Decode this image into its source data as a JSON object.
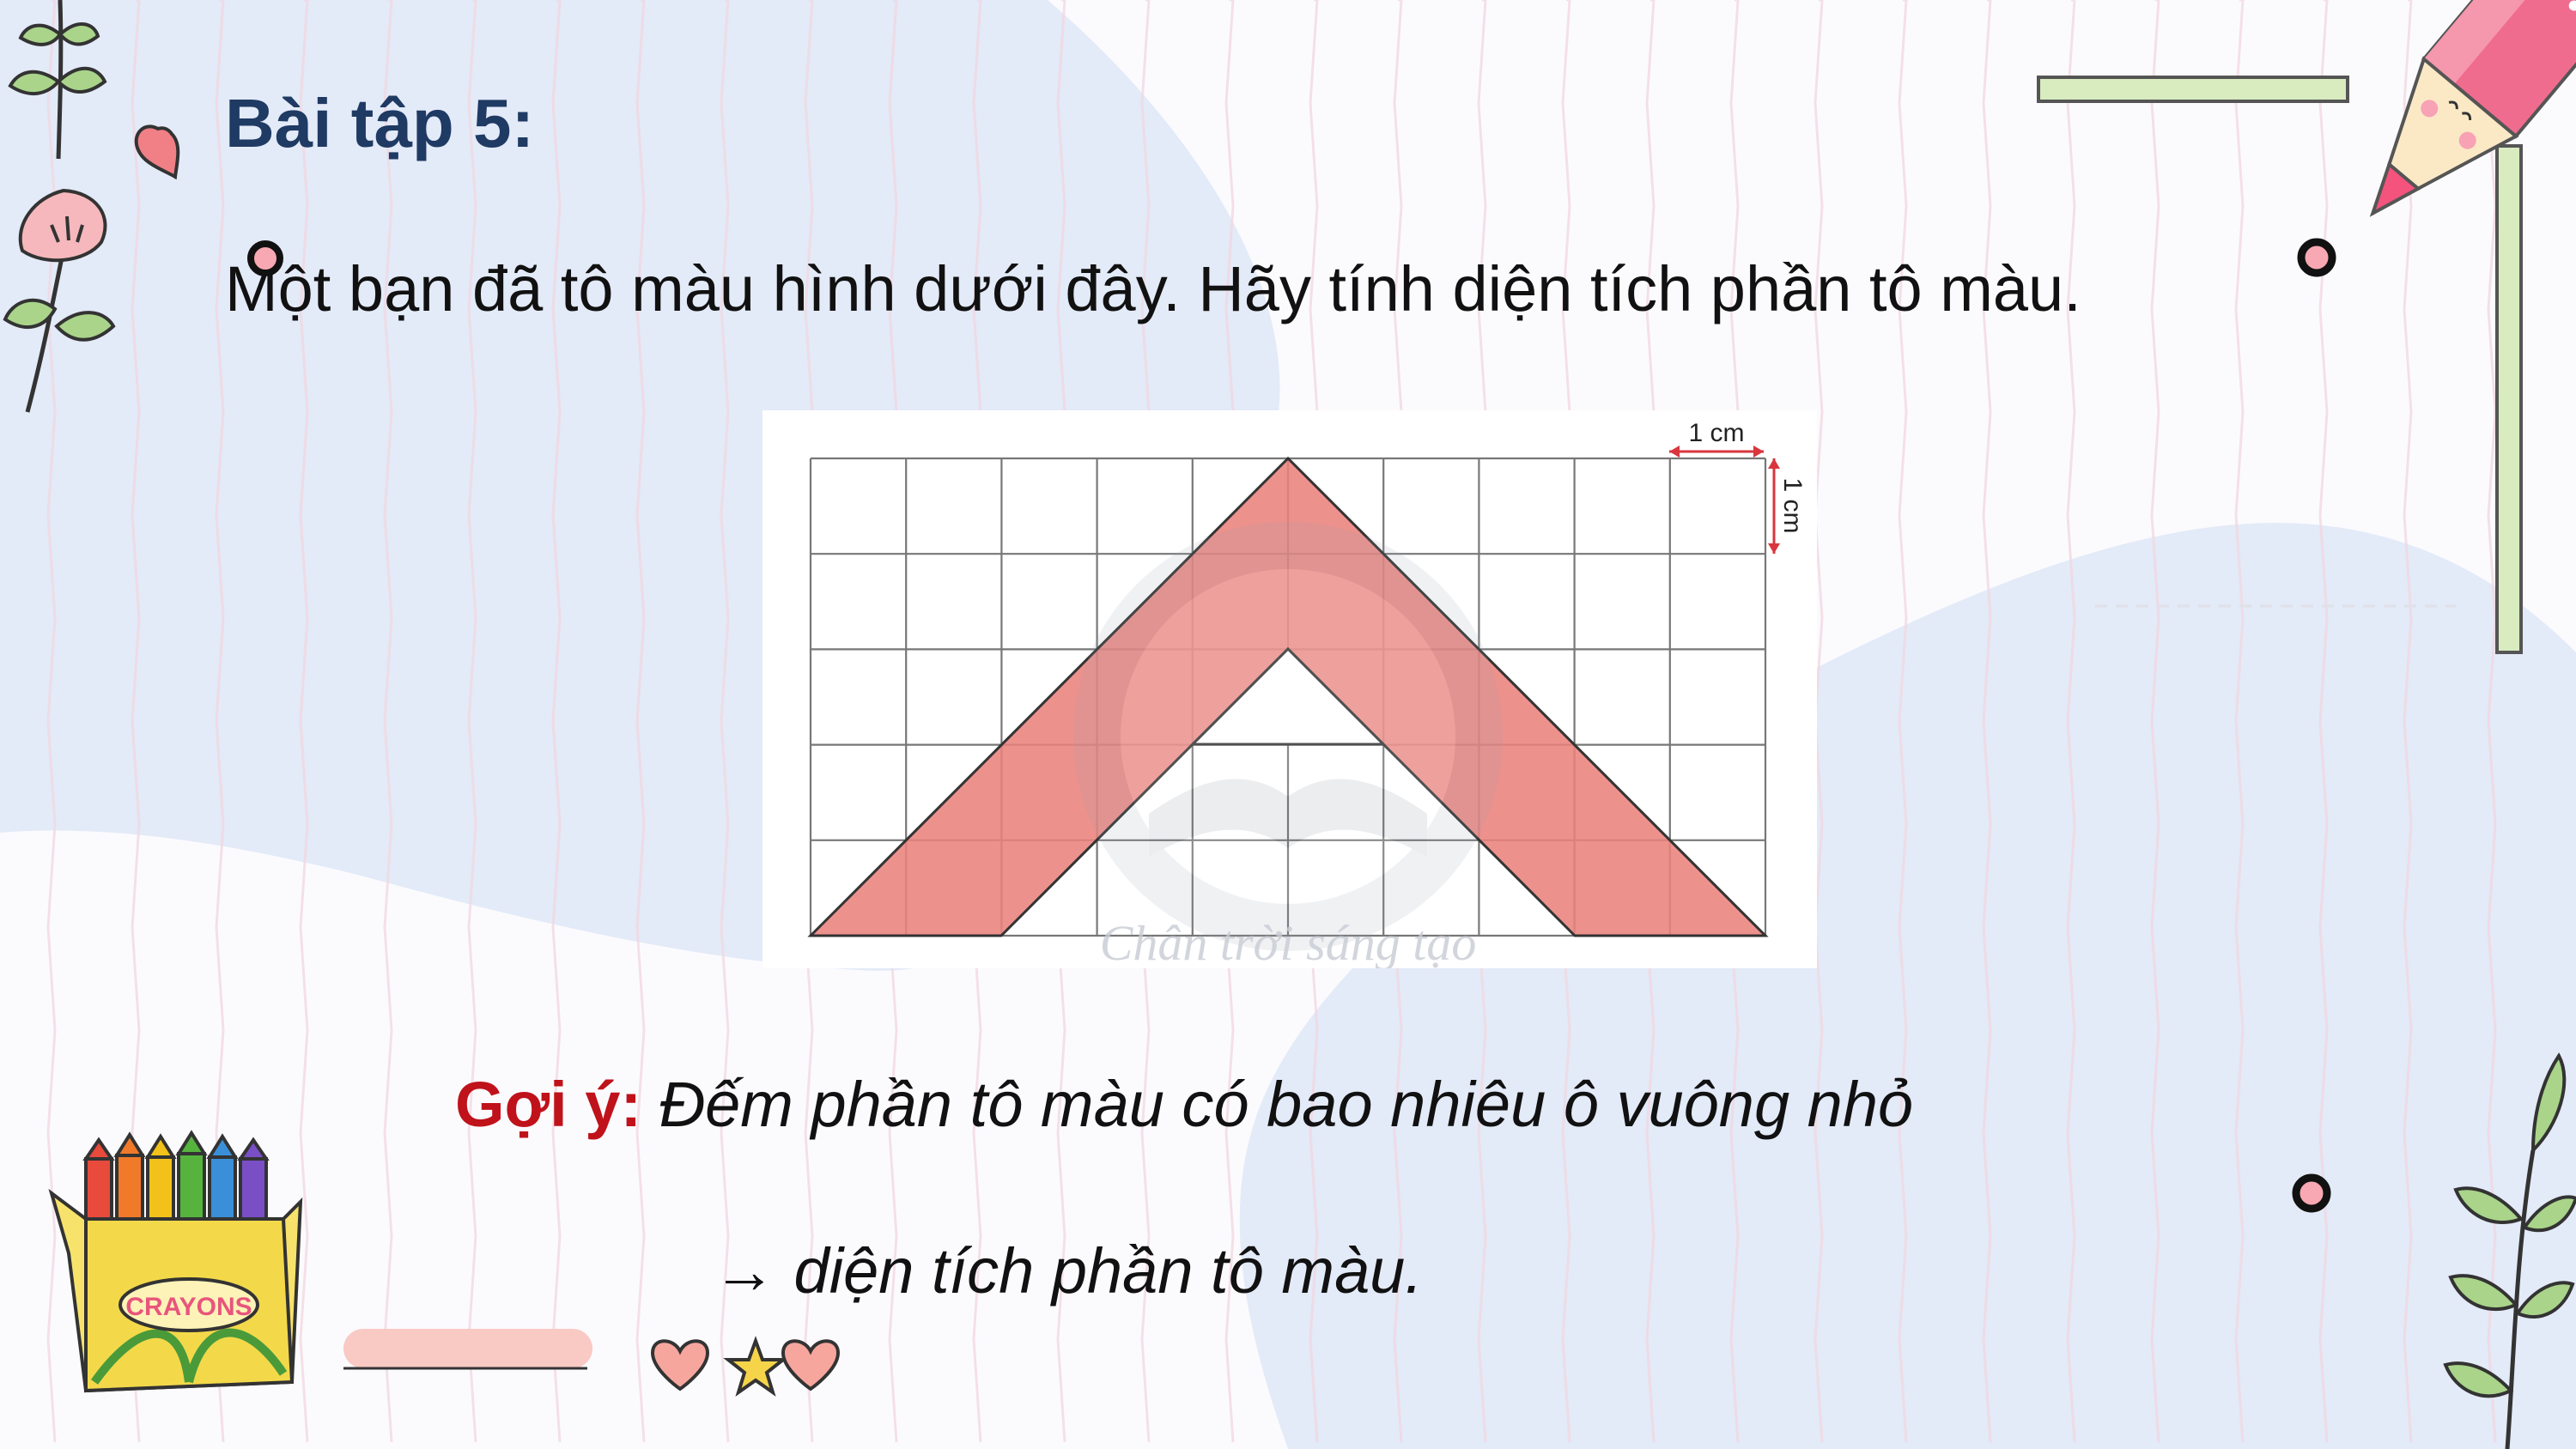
{
  "slide": {
    "title": "Bài tập 5:",
    "question": "Một bạn đã tô màu hình dưới đây. Hãy tính diện tích phần tô màu.",
    "hint_label": "Gợi ý:",
    "hint_text": "Đếm phần tô màu có bao nhiêu ô vuông nhỏ",
    "hint_line2": "→ diện tích phần tô màu."
  },
  "figure": {
    "unit_label_horizontal": "1 cm",
    "unit_label_vertical": "1 cm",
    "grid_columns": 10,
    "grid_rows": 5,
    "watermark": "Chân trời sáng tạo"
  },
  "decor": {
    "crayon_box_label": "CRAYONS"
  },
  "colors": {
    "title": "#1f3a63",
    "hint_label": "#c0121a",
    "shape_fill": "#e9827c",
    "pencil_pink": "#e8557d",
    "leaf_green": "#7fae5a",
    "blob_blue": "#e3eaf8"
  }
}
